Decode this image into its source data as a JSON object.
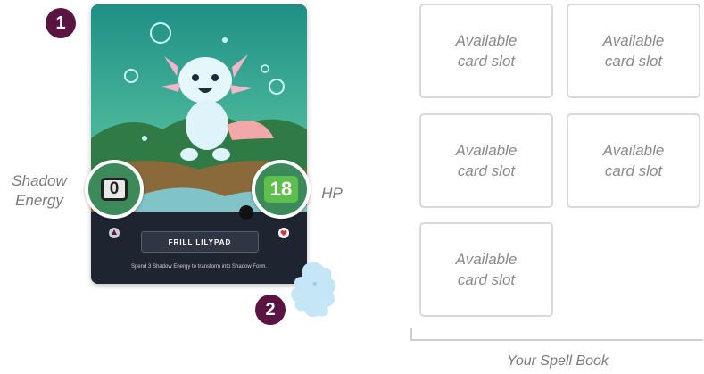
{
  "markers": {
    "one": "1",
    "two": "2"
  },
  "card": {
    "name": "FRILL LILYPAD",
    "ability": "Spend 3 Shadow Energy to transform into Shadow Form.",
    "shadow_energy": "0",
    "hp": "18"
  },
  "labels": {
    "shadow_energy": "Shadow Energy",
    "hp": "HP"
  },
  "spell_book": {
    "label": "Your Spell Book",
    "slots": [
      "Available card slot",
      "Available card slot",
      "Available card slot",
      "Available card slot",
      "Available card slot"
    ]
  },
  "colors": {
    "badge": "#5a1442",
    "hp_green": "#5ebf4d",
    "card_dark": "#1f2530",
    "art_teal": "#2fa79a"
  }
}
